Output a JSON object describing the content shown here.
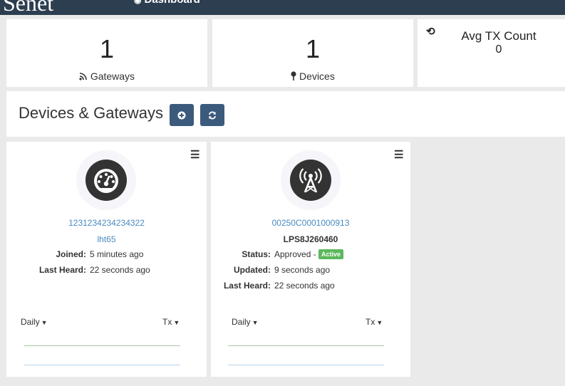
{
  "header": {
    "brand": "Senet",
    "nav_dashboard": "Dashboard"
  },
  "stats": {
    "gateways": {
      "count": "1",
      "label": "Gateways",
      "icon": "wifi-feed-icon"
    },
    "devices": {
      "count": "1",
      "label": "Devices",
      "icon": "pin-icon"
    },
    "avg_tx": {
      "label": "Avg TX Count",
      "value": "0",
      "icon": "history-icon"
    }
  },
  "section": {
    "title": "Devices & Gateways",
    "add_icon": "plus-circle-icon",
    "refresh_icon": "refresh-icon"
  },
  "cards": [
    {
      "type": "device",
      "icon": "gauge-icon",
      "id": "1231234234234322",
      "name": "lht65",
      "fields": [
        {
          "label": "Joined:",
          "value": "5 minutes ago"
        },
        {
          "label": "Last Heard:",
          "value": "22 seconds ago"
        }
      ],
      "period": "Daily",
      "metric": "Tx"
    },
    {
      "type": "gateway",
      "icon": "antenna-tower-icon",
      "id": "00250C0001000913",
      "name": "LPS8J260460",
      "status_label": "Status:",
      "status_value": "Approved -",
      "status_badge": "Active",
      "fields": [
        {
          "label": "Updated:",
          "value": "9 seconds ago"
        },
        {
          "label": "Last Heard:",
          "value": "22 seconds ago"
        }
      ],
      "period": "Daily",
      "metric": "Tx"
    }
  ],
  "colors": {
    "navbar": "#2c3e50",
    "link": "#4a8bc2",
    "button": "#3c5a7c",
    "badge": "#5cb85c",
    "icon_disc": "#333333"
  }
}
